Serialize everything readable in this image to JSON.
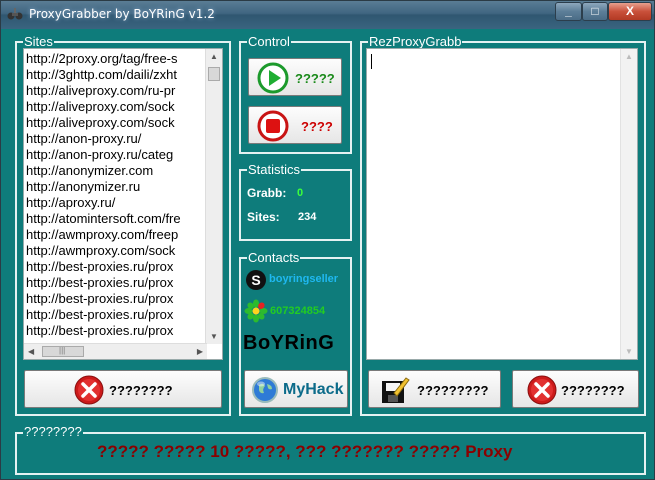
{
  "window": {
    "title": "ProxyGrabber by BoYRinG v1.2",
    "min_glyph": "_",
    "max_glyph": "□",
    "close_glyph": "X"
  },
  "sites": {
    "label": "Sites",
    "items": [
      "http://2proxy.org/tag/free-s",
      "http://3ghttp.com/daili/zxht",
      "http://aliveproxy.com/ru-pr",
      "http://aliveproxy.com/sock",
      "http://aliveproxy.com/sock",
      "http://anon-proxy.ru/",
      "http://anon-proxy.ru/categ",
      "http://anonymizer.com",
      "http://anonymizer.ru",
      "http://aproxy.ru/",
      "http://atomintersoft.com/fre",
      "http://awmproxy.com/freep",
      "http://awmproxy.com/sock",
      "http://best-proxies.ru/prox",
      "http://best-proxies.ru/prox",
      "http://best-proxies.ru/prox",
      "http://best-proxies.ru/prox",
      "http://best-proxies.ru/prox"
    ],
    "delete_label": "????????"
  },
  "control": {
    "label": "Control",
    "start_label": "?????",
    "stop_label": "????"
  },
  "statistics": {
    "label": "Statistics",
    "grabb_label": "Grabb:",
    "grabb_value": "0",
    "sites_label": "Sites:",
    "sites_value": "234"
  },
  "contacts": {
    "label": "Contacts",
    "skype": "boyringseller",
    "icq": "607324854",
    "brand": "BoYRinG",
    "myhack_label": "MyHack"
  },
  "result": {
    "label": "RezProxyGrabb",
    "text": "",
    "save_label": "?????????",
    "clear_label": "????????"
  },
  "status": {
    "label": "????????",
    "message": "????? ????? 10 ?????, ??? ??????? ????? Proxy"
  },
  "colors": {
    "background": "#0e7c7b",
    "accent_green": "#22cc22",
    "stop_red": "#dd1111",
    "status_red": "#8b0000",
    "skype_blue": "#1fb8f0"
  }
}
